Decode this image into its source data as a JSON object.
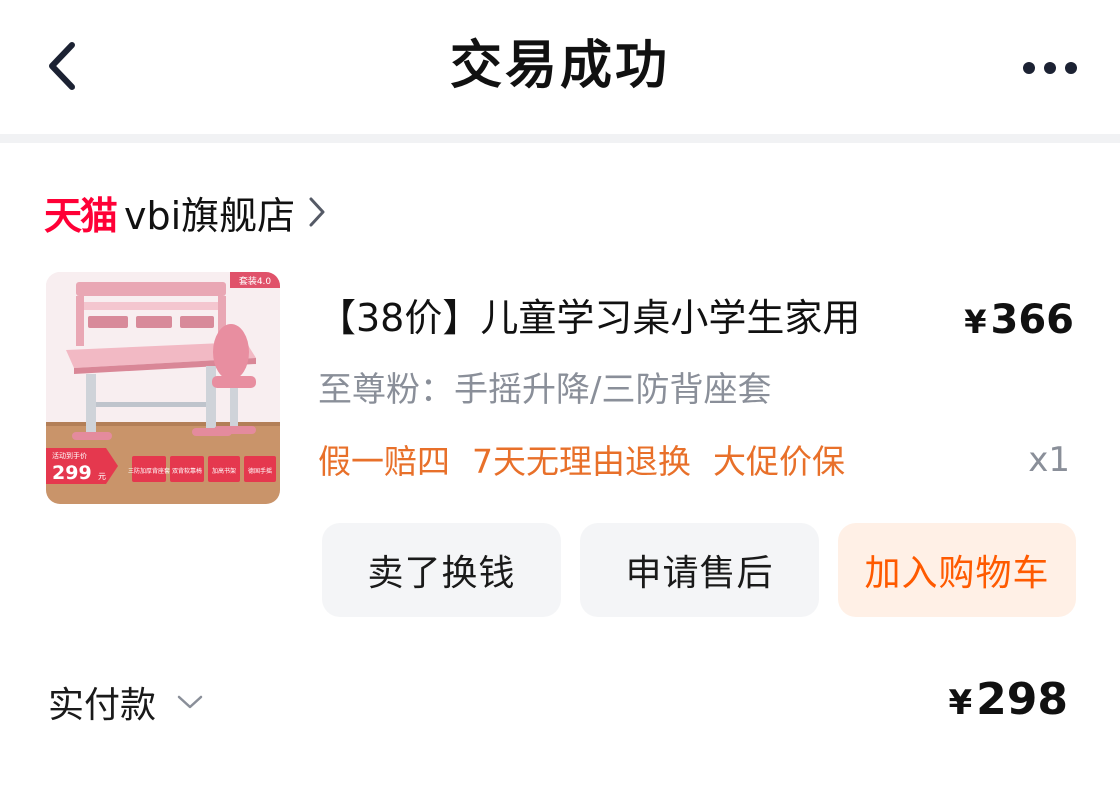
{
  "header": {
    "title": "交易成功",
    "back_icon": "chevron-left-icon",
    "more_icon": "more-dots-icon"
  },
  "shop": {
    "platform_logo": "天猫",
    "name": "vbi旗舰店",
    "chevron_icon": "chevron-right-icon"
  },
  "item": {
    "image_texts": {
      "badge": "套装4.0",
      "promo_label": "活动到手价",
      "promo_price": "299",
      "promo_unit": "元",
      "features": [
        "三防加厚背座套",
        "双背软靠椅",
        "加高书架",
        "德国手摇"
      ]
    },
    "title": "【38价】儿童学习桌小学生家用",
    "currency": "¥",
    "price": "366",
    "sku": "至尊粉：手摇升降/三防背座套",
    "promises": [
      "假一赔四",
      "7天无理由退换",
      "大促价保"
    ],
    "quantity": "x1"
  },
  "actions": {
    "sell": "卖了换钱",
    "after_sale": "申请售后",
    "add_to_cart": "加入购物车"
  },
  "payment": {
    "label": "实付款",
    "currency": "¥",
    "amount": "298"
  },
  "colors": {
    "tmall_red": "#ff0036",
    "promise_orange": "#e8702a",
    "cart_text": "#ff5a00",
    "cart_bg": "#fff0e6",
    "button_bg": "#f4f5f7",
    "muted_text": "#8a8f99"
  }
}
